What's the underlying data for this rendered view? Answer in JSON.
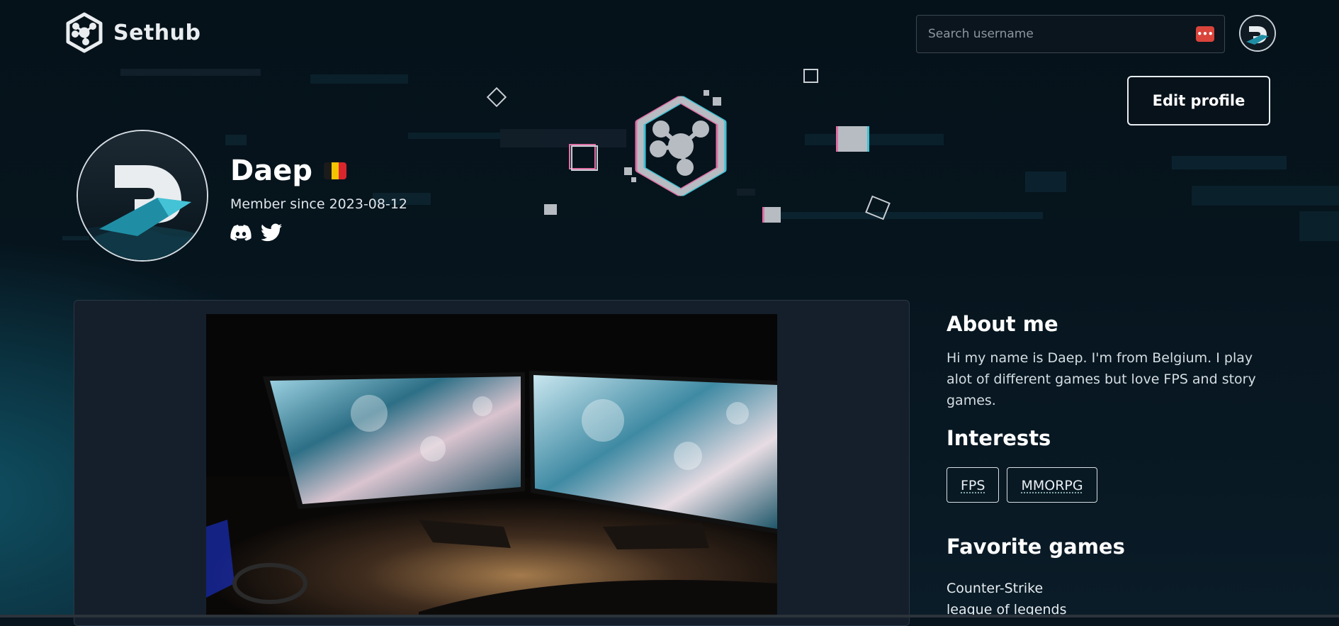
{
  "app": {
    "name": "Sethub",
    "logo_icon": "sethub-hex-logo-icon"
  },
  "search": {
    "placeholder": "Search username",
    "badge_icon": "password-manager-icon"
  },
  "header": {
    "avatar_icon": "user-avatar-icon"
  },
  "profile": {
    "edit_label": "Edit profile",
    "username": "Daep",
    "country_flag": {
      "name": "Belgium",
      "colors": [
        "#1b1b1b",
        "#f5c400",
        "#d9262e"
      ]
    },
    "member_since": "Member since 2023-08-12",
    "socials": [
      {
        "icon": "discord-icon"
      },
      {
        "icon": "twitter-icon"
      }
    ]
  },
  "setup": {
    "photo_alt": "dual-monitor-setup-photo"
  },
  "about": {
    "title": "About me",
    "text": "Hi my name is Daep. I'm from Belgium. I play alot of different games but love FPS and story games."
  },
  "interests": {
    "title": "Interests",
    "items": [
      "FPS",
      "MMORPG"
    ]
  },
  "favorites": {
    "title": "Favorite games",
    "items": [
      "Counter-Strike",
      "league of legends"
    ]
  },
  "colors": {
    "background": "#08141d",
    "accent": "#1f8ea5",
    "badge": "#d9443b"
  }
}
